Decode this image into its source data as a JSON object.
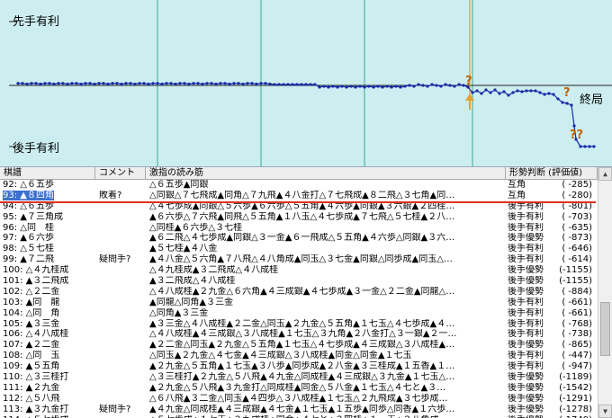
{
  "graph": {
    "sente_label": "先手有利",
    "gote_label": "後手有利",
    "end_label": "終局",
    "marker_q": "?",
    "marker_qq": "??"
  },
  "table": {
    "headers": {
      "move": "棋譜",
      "comment": "コメント",
      "pv": "激指の読み筋",
      "judge": "形勢判断 (評価値)"
    },
    "rows": [
      {
        "move": "92: △６五歩",
        "comment": "",
        "pv": "△６五歩▲同銀",
        "judge": "互角",
        "value": "( -285)"
      },
      {
        "move": "93: ▲８四角",
        "comment": "敗着?",
        "pv": "△同銀△７七飛成▲同角△７九飛▲４八金打△７七飛成▲８二飛△３七角▲同…",
        "judge": "互角",
        "value": "( -280)"
      },
      {
        "move": "94: △６五歩",
        "comment": "",
        "pv": "△４七歩成▲同銀△５六歩▲６六歩△５五角▲４六歩▲同銀▲３六銀▲２四桂…",
        "judge": "後手有利",
        "value": "( -801)"
      },
      {
        "move": "95: ▲７三角成",
        "comment": "",
        "pv": "▲６六歩△７六飛▲同飛△５五角▲１八玉△４七歩成▲７七飛△５七桂▲２八…",
        "judge": "後手有利",
        "value": "( -703)"
      },
      {
        "move": "96: △同　桂",
        "comment": "",
        "pv": "△同桂▲６六歩△３七桂",
        "judge": "後手有利",
        "value": "( -635)"
      },
      {
        "move": "97: ▲６六歩",
        "comment": "",
        "pv": "▲６二飛△４七歩成▲同銀△３一金▲６一飛成△５五角▲４六歩△同銀▲３六…",
        "judge": "後手優勢",
        "value": "( -873)"
      },
      {
        "move": "98: △５七桂",
        "comment": "",
        "pv": "▲５七桂▲４八金",
        "judge": "後手有利",
        "value": "( -646)"
      },
      {
        "move": "99: ▲７二飛",
        "comment": "疑問手?",
        "pv": "▲４八金△５六角▲７八飛△４八角成▲同玉△３七金▲同銀△同歩成▲同玉△…",
        "judge": "後手有利",
        "value": "( -614)"
      },
      {
        "move": "100: △４九桂成",
        "comment": "",
        "pv": "△４九桂成▲３二飛成△４八成桂",
        "judge": "後手優勢",
        "value": "(-1155)"
      },
      {
        "move": "101: ▲３二飛成",
        "comment": "",
        "pv": "▲３二飛成△４八成桂",
        "judge": "後手優勢",
        "value": "(-1155)"
      },
      {
        "move": "102: △２二金",
        "comment": "",
        "pv": "△４八成桂▲２九金△６六角▲４三成銀▲４七歩成▲３一金△２二金▲同龍△…",
        "judge": "後手優勢",
        "value": "( -884)"
      },
      {
        "move": "103: ▲同　龍",
        "comment": "",
        "pv": "▲同龍△同角▲３三金",
        "judge": "後手有利",
        "value": "( -661)"
      },
      {
        "move": "104: △同　角",
        "comment": "",
        "pv": "△同角▲３三金",
        "judge": "後手有利",
        "value": "( -661)"
      },
      {
        "move": "105: ▲３三金",
        "comment": "",
        "pv": "▲３三金△４八成桂▲２二金△同玉▲２九金△５五角▲１七玉△４七歩成▲４…",
        "judge": "後手有利",
        "value": "( -768)"
      },
      {
        "move": "106: △４八成桂",
        "comment": "",
        "pv": "△４八成桂▲４三成銀△３八成桂▲１七玉△３九角▲２八金打△３一銀▲２一…",
        "judge": "後手有利",
        "value": "( -738)"
      },
      {
        "move": "107: ▲２二金",
        "comment": "",
        "pv": "▲２二金△同玉▲２九金△５五角▲１七玉△４七歩成▲４三成銀△３八成桂▲…",
        "judge": "後手優勢",
        "value": "( -865)"
      },
      {
        "move": "108: △同　玉",
        "comment": "",
        "pv": "△同玉▲２九金△４七金▲４三成銀△３八成桂▲同金△同金▲１七玉",
        "judge": "後手有利",
        "value": "( -447)"
      },
      {
        "move": "109: ▲５五角",
        "comment": "",
        "pv": "▲２九金△５五角▲１七玉▲３八歩▲同歩成▲２八金▲３三桂成▲１五香▲１…",
        "judge": "後手有利",
        "value": "( -947)"
      },
      {
        "move": "110: △３三桂打",
        "comment": "",
        "pv": "△３三桂打▲２九金△５八飛▲４九金△同成桂▲４三成銀△３九金▲１七玉△…",
        "judge": "後手優勢",
        "value": "(-1189)"
      },
      {
        "move": "111: ▲２九金",
        "comment": "",
        "pv": "▲２九金△５八飛▲３九金打△同成桂▲同金△５八金▲１七玉△４七と▲３…",
        "judge": "後手優勢",
        "value": "(-1542)"
      },
      {
        "move": "112: △５八飛",
        "comment": "",
        "pv": "△６八飛▲３二金△同玉▲４四歩△３八成桂▲１七玉△２九飛成▲３七歩成…",
        "judge": "後手優勢",
        "value": "(-1291)"
      },
      {
        "move": "113: ▲３九金打",
        "comment": "疑問手?",
        "pv": "▲４九金△同成桂▲４三成銀▲４七金▲１七玉▲１五歩▲同歩△同香▲１六歩…",
        "judge": "後手優勢",
        "value": "(-1278)"
      },
      {
        "move": "114: △５七歩成",
        "comment": "",
        "pv": "△５七歩成▲１七玉△３九成桂▲同金△４七と▲３四桂△１一玉▲３八角成…",
        "judge": "後手優勢",
        "value": "(-1749)"
      }
    ]
  }
}
